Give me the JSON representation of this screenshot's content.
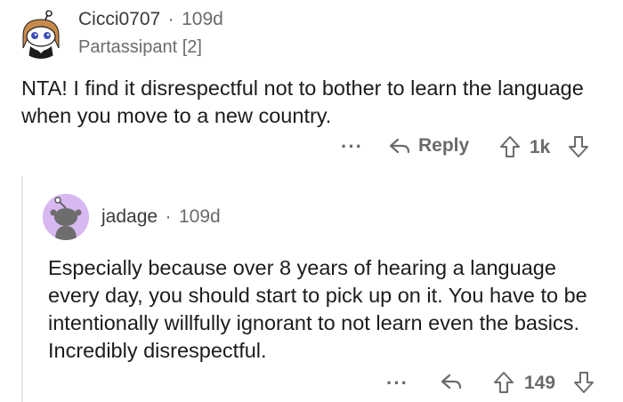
{
  "comment": {
    "username": "Cicci0707",
    "separator": "·",
    "age": "109d",
    "flair": "Partassipant [2]",
    "body": "NTA! I find it disrespectful not to bother to learn the language when you move to a new country.",
    "more_label": "···",
    "reply_label": "Reply",
    "score": "1k",
    "avatar_icon": "snoo-avatar-icon"
  },
  "reply": {
    "username": "jadage",
    "separator": "·",
    "age": "109d",
    "body": "Especially because over 8 years of hearing a language every day, you should start to pick up on it. You have to be intentionally willfully ignorant to not learn even the basics. Incredibly disrespectful.",
    "more_label": "···",
    "score": "149",
    "avatar_icon": "default-snoo-avatar-icon"
  },
  "colors": {
    "text": "#1c1c1c",
    "muted": "#6b6b6b",
    "reply_avatar_bg": "#d7b8f0",
    "thread_line": "#e6e6e6"
  }
}
